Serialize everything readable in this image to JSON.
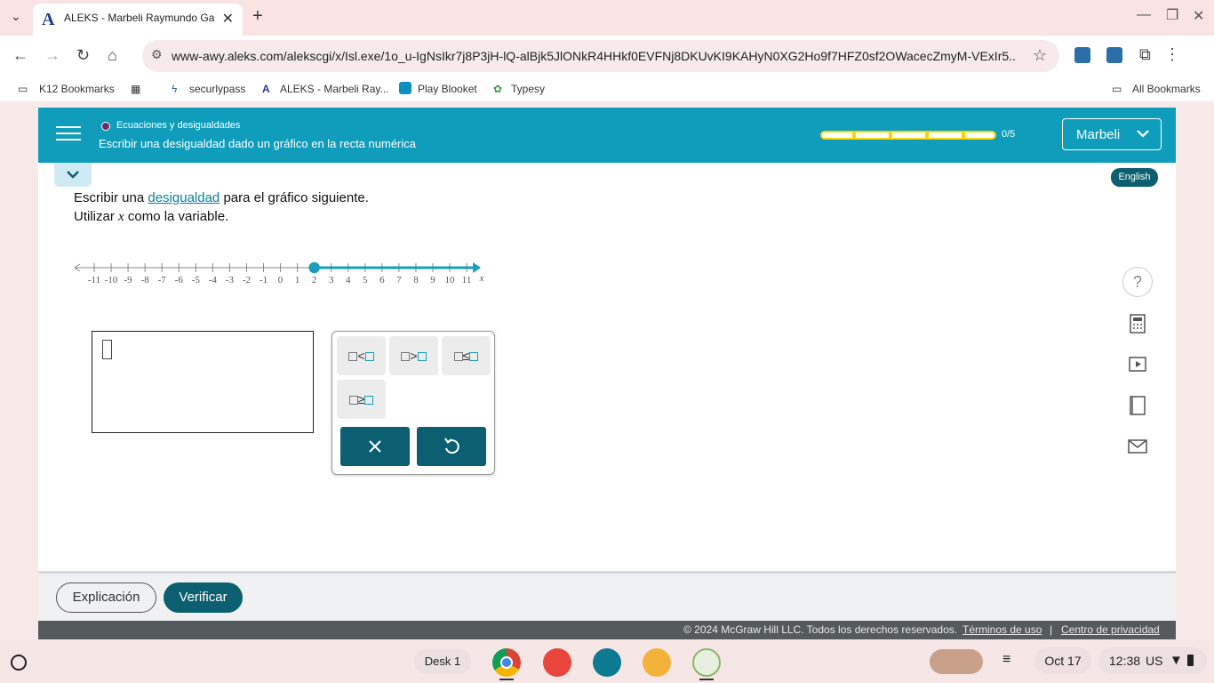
{
  "browser": {
    "tab_title": "ALEKS - Marbeli Raymundo Ga",
    "url": "www-awy.aleks.com/alekscgi/x/Isl.exe/1o_u-IgNsIkr7j8P3jH-lQ-alBjk5JlONkR4HHkf0EVFNj8DKUvKI9KAHyN0XG2Ho9f7HFZ0sf2OWacecZmyM-VExIr5...",
    "bookmarks": [
      "K12 Bookmarks",
      "securlypass",
      "ALEKS - Marbeli Ray...",
      "Play Blooket",
      "Typesy"
    ],
    "all_bookmarks": "All Bookmarks"
  },
  "header": {
    "topic": "Ecuaciones y desigualdades",
    "subtopic": "Escribir una desigualdad dado un gráfico en la recta numérica",
    "progress_text": "0/5",
    "progress_value": 0,
    "user_name": "Marbeli"
  },
  "language_label": "English",
  "instructions": {
    "line1_pre": "Escribir una ",
    "line1_link": "desigualdad",
    "line1_post": " para el gráfico siguiente.",
    "line2_pre": "Utilizar ",
    "line2_var": "x",
    "line2_post": " como la variable."
  },
  "number_line": {
    "ticks": [
      "-11",
      "-10",
      "-9",
      "-8",
      "-7",
      "-6",
      "-5",
      "-4",
      "-3",
      "-2",
      "-1",
      "0",
      "1",
      "2",
      "3",
      "4",
      "5",
      "6",
      "7",
      "8",
      "9",
      "10",
      "11"
    ],
    "variable": "x",
    "point": 2,
    "closed": true,
    "direction": "right",
    "color": "#1a9dbb"
  },
  "keypad": {
    "keys": [
      "<",
      ">",
      "≤",
      "≥"
    ],
    "clear_icon": "close-icon",
    "undo_icon": "undo-icon"
  },
  "side_tools": [
    "help-icon",
    "calculator-icon",
    "video-icon",
    "dictionary-icon",
    "mail-icon"
  ],
  "footer": {
    "explanation": "Explicación",
    "verify": "Verificar",
    "copyright": "© 2024 McGraw Hill LLC. Todos los derechos reservados.",
    "terms": "Términos de uso",
    "separator": "|",
    "privacy": "Centro de privacidad"
  },
  "shelf": {
    "desk": "Desk 1",
    "date": "Oct 17",
    "time": "12:38",
    "locale": "US"
  }
}
